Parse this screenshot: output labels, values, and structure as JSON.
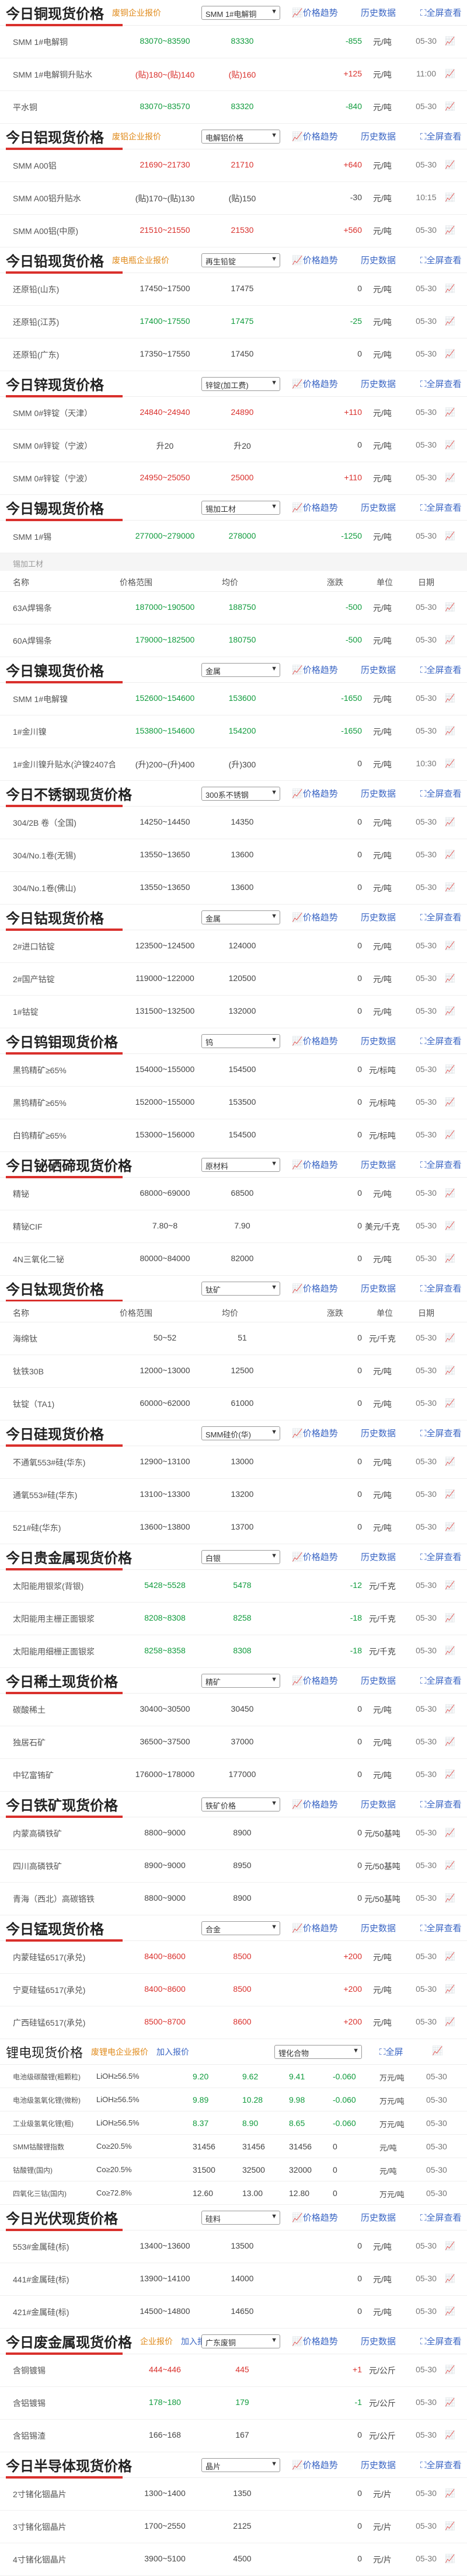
{
  "common": {
    "price_history": "价格趋势",
    "history_data": "历史数据",
    "all_view": "全屏查看"
  },
  "sections": [
    {
      "title": "今日铜现货价格",
      "tag": "废铜企业报价",
      "select": "SMM 1#电解铜",
      "rows": [
        {
          "name": "SMM 1#电解铜",
          "range": "83070~83590",
          "avg": "83330",
          "chg": "-855",
          "unit": "元/吨",
          "date": "05-30",
          "color": "green"
        },
        {
          "name": "SMM 1#电解铜升贴水",
          "range": "(贴)180~(贴)140",
          "avg": "(贴)160",
          "chg": "+125",
          "unit": "元/吨",
          "date": "11:00",
          "color": "red"
        },
        {
          "name": "平水铜",
          "range": "83070~83570",
          "avg": "83320",
          "chg": "-840",
          "unit": "元/吨",
          "date": "05-30",
          "color": "green"
        }
      ]
    },
    {
      "title": "今日铝现货价格",
      "tag": "废铝企业报价",
      "select": "电解铝价格",
      "rows": [
        {
          "name": "SMM A00铝",
          "range": "21690~21730",
          "avg": "21710",
          "chg": "+640",
          "unit": "元/吨",
          "date": "05-30",
          "color": "red"
        },
        {
          "name": "SMM A00铝升贴水",
          "range": "(贴)170~(贴)130",
          "avg": "(贴)150",
          "chg": "-30",
          "unit": "元/吨",
          "date": "10:15",
          "color": "none"
        },
        {
          "name": "SMM A00铝(中原)",
          "range": "21510~21550",
          "avg": "21530",
          "chg": "+560",
          "unit": "元/吨",
          "date": "05-30",
          "color": "red"
        }
      ]
    },
    {
      "title": "今日铅现货价格",
      "tag": "废电瓶企业报价",
      "select": "再生铅锭",
      "rows": [
        {
          "name": "还原铅(山东)",
          "range": "17450~17500",
          "avg": "17475",
          "chg": "0",
          "unit": "元/吨",
          "date": "05-30",
          "color": "none"
        },
        {
          "name": "还原铅(江苏)",
          "range": "17400~17550",
          "avg": "17475",
          "chg": "-25",
          "unit": "元/吨",
          "date": "05-30",
          "color": "green"
        },
        {
          "name": "还原铅(广东)",
          "range": "17350~17550",
          "avg": "17450",
          "chg": "0",
          "unit": "元/吨",
          "date": "05-30",
          "color": "none"
        }
      ]
    },
    {
      "title": "今日锌现货价格",
      "tag": "",
      "select": "锌锭(加工费)",
      "rows": [
        {
          "name": "SMM 0#锌锭（天津）",
          "range": "24840~24940",
          "avg": "24890",
          "chg": "+110",
          "unit": "元/吨",
          "date": "05-30",
          "color": "red"
        },
        {
          "name": "SMM 0#锌锭（宁波）",
          "range": "升20",
          "avg": "升20",
          "chg": "0",
          "unit": "元/吨",
          "date": "05-30",
          "color": "none"
        },
        {
          "name": "SMM 0#锌锭（宁波）",
          "range": "24950~25050",
          "avg": "25000",
          "chg": "+110",
          "unit": "元/吨",
          "date": "05-30",
          "color": "red"
        }
      ]
    },
    {
      "title": "今日锡现货价格",
      "tag": "",
      "select": "锡加工材",
      "rows": [
        {
          "name": "SMM 1#锡",
          "range": "277000~279000",
          "avg": "278000",
          "chg": "-1250",
          "unit": "元/吨",
          "date": "05-30",
          "color": "green"
        }
      ]
    }
  ],
  "tin_block": {
    "caption": "锡加工材",
    "headers": [
      "名称",
      "价格范围",
      "均价",
      "涨跌",
      "单位",
      "日期"
    ],
    "rows": [
      {
        "name": "63A焊锡条",
        "range": "187000~190500",
        "avg": "188750",
        "chg": "-500",
        "unit": "元/吨",
        "date": "05-30",
        "color": "green"
      },
      {
        "name": "60A焊锡条",
        "range": "179000~182500",
        "avg": "180750",
        "chg": "-500",
        "unit": "元/吨",
        "date": "05-30",
        "color": "green"
      }
    ]
  },
  "sections2": [
    {
      "title": "今日镍现货价格",
      "tag": "",
      "select": "金属",
      "rows": [
        {
          "name": "SMM 1#电解镍",
          "range": "152600~154600",
          "avg": "153600",
          "chg": "-1650",
          "unit": "元/吨",
          "date": "05-30",
          "color": "green"
        },
        {
          "name": "1#金川镍",
          "range": "153800~154600",
          "avg": "154200",
          "chg": "-1650",
          "unit": "元/吨",
          "date": "05-30",
          "color": "green"
        },
        {
          "name": "1#金川镍升贴水(沪镍2407合约)",
          "range": "(升)200~(升)400",
          "avg": "(升)300",
          "chg": "0",
          "unit": "元/吨",
          "date": "10:30",
          "color": "none"
        }
      ]
    },
    {
      "title": "今日不锈钢现货价格",
      "tag": "",
      "select": "300系不锈钢",
      "rows": [
        {
          "name": "304/2B 卷（全国)",
          "range": "14250~14450",
          "avg": "14350",
          "chg": "0",
          "unit": "元/吨",
          "date": "05-30",
          "color": "none"
        },
        {
          "name": "304/No.1卷(无锡)",
          "range": "13550~13650",
          "avg": "13600",
          "chg": "0",
          "unit": "元/吨",
          "date": "05-30",
          "color": "none"
        },
        {
          "name": "304/No.1卷(佛山)",
          "range": "13550~13650",
          "avg": "13600",
          "chg": "0",
          "unit": "元/吨",
          "date": "05-30",
          "color": "none"
        }
      ]
    },
    {
      "title": "今日钴现货价格",
      "tag": "",
      "select": "金属",
      "rows": [
        {
          "name": "2#进口钴锭",
          "range": "123500~124500",
          "avg": "124000",
          "chg": "0",
          "unit": "元/吨",
          "date": "05-30",
          "color": "none"
        },
        {
          "name": "2#国产钴锭",
          "range": "119000~122000",
          "avg": "120500",
          "chg": "0",
          "unit": "元/吨",
          "date": "05-30",
          "color": "none"
        },
        {
          "name": "1#钴锭",
          "range": "131500~132500",
          "avg": "132000",
          "chg": "0",
          "unit": "元/吨",
          "date": "05-30",
          "color": "none"
        }
      ]
    },
    {
      "title": "今日钨钼现货价格",
      "tag": "",
      "select": "钨",
      "rows": [
        {
          "name": "黑钨精矿≥65%",
          "range": "154000~155000",
          "avg": "154500",
          "chg": "0",
          "unit": "元/标吨",
          "date": "05-30",
          "color": "none"
        },
        {
          "name": "黑钨精矿≥65%",
          "range": "152000~155000",
          "avg": "153500",
          "chg": "0",
          "unit": "元/标吨",
          "date": "05-30",
          "color": "none"
        },
        {
          "name": "白钨精矿≥65%",
          "range": "153000~156000",
          "avg": "154500",
          "chg": "0",
          "unit": "元/标吨",
          "date": "05-30",
          "color": "none"
        }
      ]
    },
    {
      "title": "今日铋硒碲现货价格",
      "tag": "",
      "select": "原材料",
      "rows": [
        {
          "name": "精铋",
          "range": "68000~69000",
          "avg": "68500",
          "chg": "0",
          "unit": "元/吨",
          "date": "05-30",
          "color": "none"
        },
        {
          "name": "精铋CIF",
          "range": "7.80~8",
          "avg": "7.90",
          "chg": "0",
          "unit": "美元/千克",
          "date": "05-30",
          "color": "none"
        },
        {
          "name": "4N三氧化二铋",
          "range": "80000~84000",
          "avg": "82000",
          "chg": "0",
          "unit": "元/吨",
          "date": "05-30",
          "color": "none"
        }
      ]
    }
  ],
  "ti_block": {
    "title": "今日钛现货价格",
    "select": "钛矿",
    "headers": [
      "名称",
      "价格范围",
      "均价",
      "涨跌",
      "单位",
      "日期"
    ],
    "rows": [
      {
        "name": "海绵钛",
        "range": "50~52",
        "avg": "51",
        "chg": "0",
        "unit": "元/千克",
        "date": "05-30",
        "color": "none"
      },
      {
        "name": "钛铁30B",
        "range": "12000~13000",
        "avg": "12500",
        "chg": "0",
        "unit": "元/吨",
        "date": "05-30",
        "color": "none"
      },
      {
        "name": "钛锭（TA1)",
        "range": "60000~62000",
        "avg": "61000",
        "chg": "0",
        "unit": "元/吨",
        "date": "05-30",
        "color": "none"
      }
    ]
  },
  "sections3": [
    {
      "title": "今日硅现货价格",
      "tag": "",
      "select": "SMM硅价(华)",
      "rows": [
        {
          "name": "不通氧553#硅(华东)",
          "range": "12900~13100",
          "avg": "13000",
          "chg": "0",
          "unit": "元/吨",
          "date": "05-30",
          "color": "none"
        },
        {
          "name": "通氧553#硅(华东)",
          "range": "13100~13300",
          "avg": "13200",
          "chg": "0",
          "unit": "元/吨",
          "date": "05-30",
          "color": "none"
        },
        {
          "name": "521#硅(华东)",
          "range": "13600~13800",
          "avg": "13700",
          "chg": "0",
          "unit": "元/吨",
          "date": "05-30",
          "color": "none"
        }
      ]
    },
    {
      "title": "今日贵金属现货价格",
      "tag": "",
      "select": "白银",
      "rows": [
        {
          "name": "太阳能用银浆(背银)",
          "range": "5428~5528",
          "avg": "5478",
          "chg": "-12",
          "unit": "元/千克",
          "date": "05-30",
          "color": "green"
        },
        {
          "name": "太阳能用主栅正面银浆",
          "range": "8208~8308",
          "avg": "8258",
          "chg": "-18",
          "unit": "元/千克",
          "date": "05-30",
          "color": "green"
        },
        {
          "name": "太阳能用细栅正面银浆",
          "range": "8258~8358",
          "avg": "8308",
          "chg": "-18",
          "unit": "元/千克",
          "date": "05-30",
          "color": "green"
        }
      ]
    },
    {
      "title": "今日稀土现货价格",
      "tag": "",
      "select": "精矿",
      "rows": [
        {
          "name": "碳酸稀土",
          "range": "30400~30500",
          "avg": "30450",
          "chg": "0",
          "unit": "元/吨",
          "date": "05-30",
          "color": "none"
        },
        {
          "name": "独居石矿",
          "range": "36500~37500",
          "avg": "37000",
          "chg": "0",
          "unit": "元/吨",
          "date": "05-30",
          "color": "none"
        },
        {
          "name": "中钇富铕矿",
          "range": "176000~178000",
          "avg": "177000",
          "chg": "0",
          "unit": "元/吨",
          "date": "05-30",
          "color": "none"
        }
      ]
    },
    {
      "title": "今日铁矿现货价格",
      "tag": "",
      "select": "铁矿价格",
      "rows": [
        {
          "name": "内蒙高磷铁矿",
          "range": "8800~9000",
          "avg": "8900",
          "chg": "0",
          "unit": "元/50基吨",
          "date": "05-30",
          "color": "none"
        },
        {
          "name": "四川高磷铁矿",
          "range": "8900~9000",
          "avg": "8950",
          "chg": "0",
          "unit": "元/50基吨",
          "date": "05-30",
          "color": "none"
        },
        {
          "name": "青海（西北）高碳铬铁",
          "range": "8800~9000",
          "avg": "8900",
          "chg": "0",
          "unit": "元/50基吨",
          "date": "05-30",
          "color": "none"
        }
      ]
    },
    {
      "title": "今日锰现货价格",
      "tag": "",
      "select": "合金",
      "rows": [
        {
          "name": "内蒙硅锰6517(承兑)",
          "range": "8400~8600",
          "avg": "8500",
          "chg": "+200",
          "unit": "元/吨",
          "date": "05-30",
          "color": "red"
        },
        {
          "name": "宁夏硅锰6517(承兑)",
          "range": "8400~8600",
          "avg": "8500",
          "chg": "+200",
          "unit": "元/吨",
          "date": "05-30",
          "color": "red"
        },
        {
          "name": "广西硅锰6517(承兑)",
          "range": "8500~8700",
          "avg": "8600",
          "chg": "+200",
          "unit": "元/吨",
          "date": "05-30",
          "color": "red"
        }
      ]
    }
  ],
  "li_block": {
    "title": "锂电现货价格",
    "tag": "废锂电企业报价",
    "tag2": "加入报价",
    "select": "锂化合物",
    "btn": "全屏",
    "rows": [
      {
        "name": "电池级碳酸锂(粗颗粒)",
        "sub": "LiOH≥56.5%",
        "lo": "9.20",
        "hi": "9.62",
        "avg": "9.41",
        "chg": "-0.060",
        "unit": "万元/吨",
        "date": "05-30"
      },
      {
        "name": "电池级氢氧化锂(微粉)",
        "sub": "LiOH≥56.5%",
        "lo": "9.89",
        "hi": "10.28",
        "avg": "9.98",
        "chg": "-0.060",
        "unit": "万元/吨",
        "date": "05-30"
      },
      {
        "name": "工业级氢氧化锂(粗)",
        "sub": "LiOH≥56.5%",
        "lo": "8.37",
        "hi": "8.90",
        "avg": "8.65",
        "chg": "-0.060",
        "unit": "万元/吨",
        "date": "05-30"
      },
      {
        "name": "SMM钴酸锂指数",
        "sub": "Co≥20.5%",
        "lo": "31456",
        "hi": "31456",
        "avg": "31456",
        "chg": "0",
        "unit": "元/吨",
        "date": "05-30"
      },
      {
        "name": "钴酸锂(国内)",
        "sub": "Co≥20.5%",
        "lo": "31500",
        "hi": "32500",
        "avg": "32000",
        "chg": "0",
        "unit": "元/吨",
        "date": "05-30"
      },
      {
        "name": "四氧化三钴(国内)",
        "sub": "Co≥72.8%",
        "lo": "12.60",
        "hi": "13.00",
        "avg": "12.80",
        "chg": "0",
        "unit": "万元/吨",
        "date": "05-30"
      }
    ]
  },
  "sections4": [
    {
      "title": "今日光伏现货价格",
      "tag": "",
      "select": "硅料",
      "rows": [
        {
          "name": "553#金属硅(标)",
          "range": "13400~13600",
          "avg": "13500",
          "chg": "0",
          "unit": "元/吨",
          "date": "05-30",
          "color": "none"
        },
        {
          "name": "441#金属硅(标)",
          "range": "13900~14100",
          "avg": "14000",
          "chg": "0",
          "unit": "元/吨",
          "date": "05-30",
          "color": "none"
        },
        {
          "name": "421#金属硅(标)",
          "range": "14500~14800",
          "avg": "14650",
          "chg": "0",
          "unit": "元/吨",
          "date": "05-30",
          "color": "none"
        }
      ]
    },
    {
      "title": "今日废金属现货价格",
      "tag": "企业报价",
      "tag2": "加入报价",
      "select": "广东废铜",
      "rows": [
        {
          "name": "含铜镀锡",
          "range": "444~446",
          "avg": "445",
          "chg": "+1",
          "unit": "元/公斤",
          "date": "05-30",
          "color": "red"
        },
        {
          "name": "含铝镀锡",
          "range": "178~180",
          "avg": "179",
          "chg": "-1",
          "unit": "元/公斤",
          "date": "05-30",
          "color": "green"
        },
        {
          "name": "含铝锡渣",
          "range": "166~168",
          "avg": "167",
          "chg": "0",
          "unit": "元/公斤",
          "date": "05-30",
          "color": "none"
        }
      ]
    },
    {
      "title": "今日半导体现货价格",
      "tag": "",
      "select": "晶片",
      "rows": [
        {
          "name": "2寸锗化铟晶片",
          "range": "1300~1400",
          "avg": "1350",
          "chg": "0",
          "unit": "元/片",
          "date": "05-30",
          "color": "none"
        },
        {
          "name": "3寸锗化铟晶片",
          "range": "1700~2550",
          "avg": "2125",
          "chg": "0",
          "unit": "元/片",
          "date": "05-30",
          "color": "none"
        },
        {
          "name": "4寸锗化铟晶片",
          "range": "3900~5100",
          "avg": "4500",
          "chg": "0",
          "unit": "元/片",
          "date": "05-30",
          "color": "none"
        }
      ]
    }
  ]
}
